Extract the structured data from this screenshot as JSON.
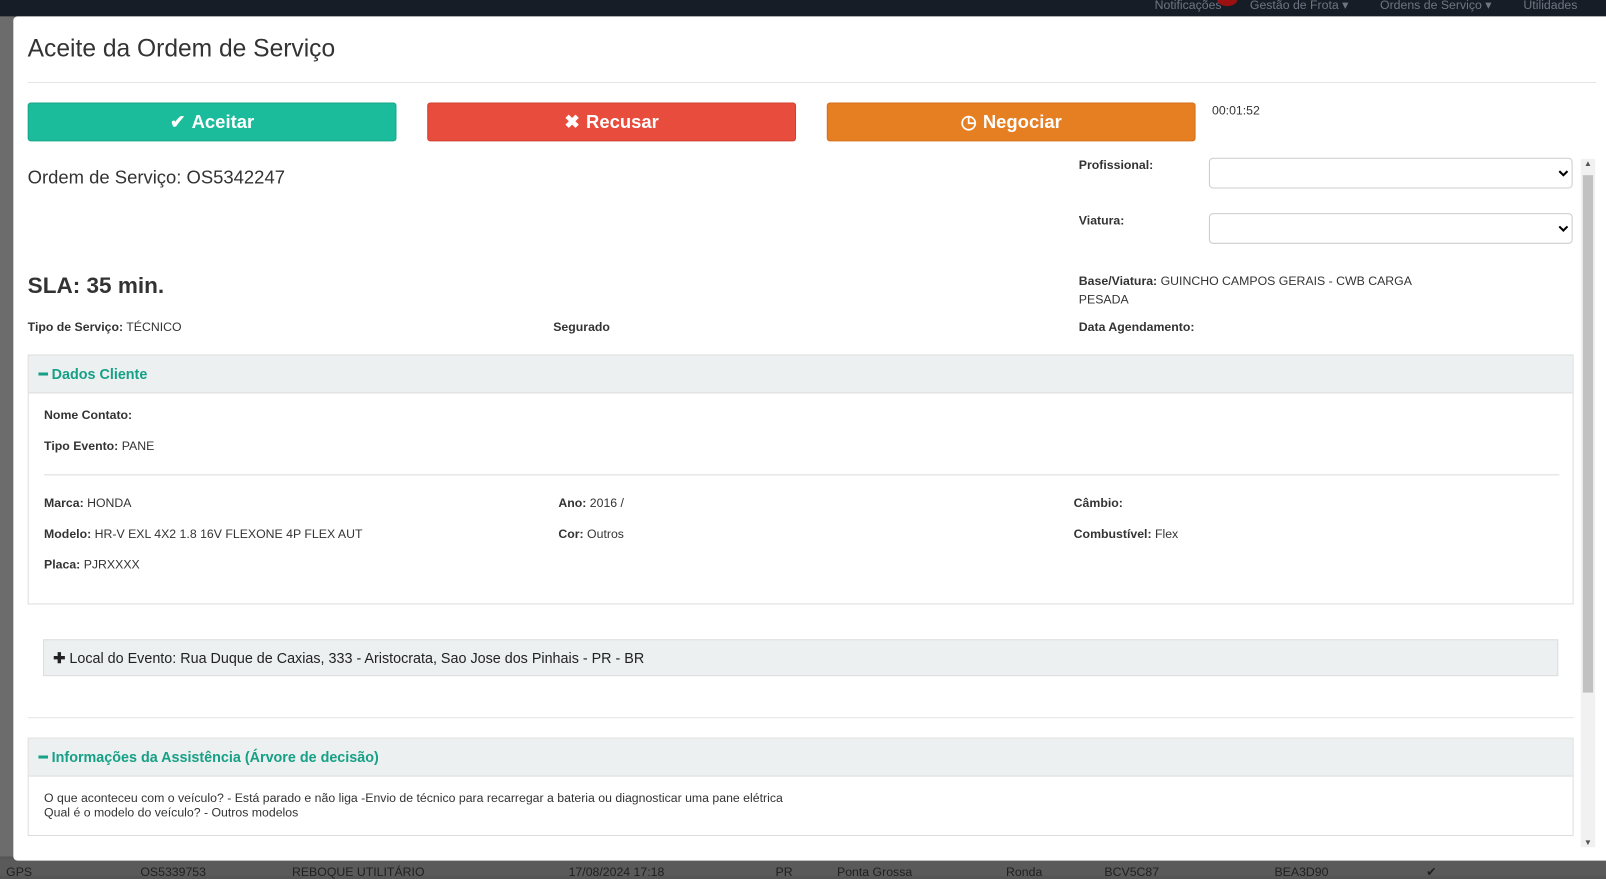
{
  "background": {
    "nav": [
      "Notificações",
      "Gestão de Frota ▾",
      "Ordens de Serviço ▾",
      "Utilidades"
    ],
    "row": [
      "GPS",
      "OS5339753",
      "REBOQUE UTILITÁRIO",
      "17/08/2024 17:18",
      "PR",
      "Ponta Grossa",
      "Ronda",
      "BCV5C87",
      "BEA3D90",
      "✔"
    ]
  },
  "modal": {
    "title": "Aceite da Ordem de Serviço",
    "buttons": {
      "accept": "Aceitar",
      "refuse": "Recusar",
      "negotiate": "Negociar"
    },
    "colors": {
      "accept": "#1abc9c",
      "refuse": "#e74c3c",
      "negotiate": "#e67e22",
      "section": "#16a085"
    },
    "timer": "00:01:52",
    "os_label": "Ordem de Serviço: OS5342247",
    "sla": "SLA: 35 min.",
    "profissional_label": "Profissional:",
    "viatura_label": "Viatura:",
    "base_label": "Base/Viatura:",
    "base_value": "GUINCHO CAMPOS GERAIS - CWB CARGA PESADA",
    "tipo_servico_label": "Tipo de Serviço:",
    "tipo_servico_value": "TÉCNICO",
    "segurado_label": "Segurado",
    "data_agendamento_label": "Data Agendamento:",
    "dados_cliente": {
      "title": "Dados Cliente",
      "nome_contato_label": "Nome Contato:",
      "tipo_evento_label": "Tipo Evento:",
      "tipo_evento_value": "PANE",
      "marca_label": "Marca:",
      "marca_value": "HONDA",
      "modelo_label": "Modelo:",
      "modelo_value": "HR-V EXL 4X2 1.8 16V FLEXONE 4P FLEX AUT",
      "placa_label": "Placa:",
      "placa_value": "PJRXXXX",
      "ano_label": "Ano:",
      "ano_value": "2016 /",
      "cor_label": "Cor:",
      "cor_value": "Outros",
      "cambio_label": "Câmbio:",
      "combustivel_label": "Combustível:",
      "combustivel_value": "Flex"
    },
    "local": "Local do Evento: Rua Duque de Caxias, 333 - Aristocrata, Sao Jose dos Pinhais - PR - BR",
    "assistencia": {
      "title": "Informações da Assistência (Árvore de decisão)",
      "lines": [
        "O que aconteceu com o veículo? - Está parado e não liga -Envio de técnico para recarregar a bateria ou diagnosticar uma pane elétrica",
        "Qual é o modelo do veículo? - Outros modelos"
      ]
    }
  }
}
